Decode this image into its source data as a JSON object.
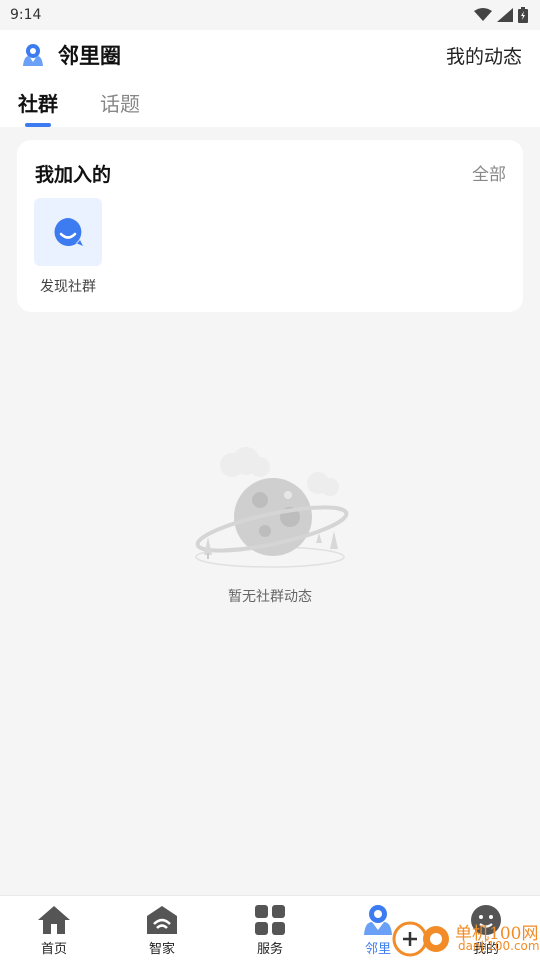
{
  "status_bar": {
    "time": "9:14"
  },
  "header": {
    "title": "邻里圈",
    "my_activity": "我的动态"
  },
  "tabs": [
    {
      "label": "社群",
      "active": true
    },
    {
      "label": "话题",
      "active": false
    }
  ],
  "joined": {
    "title": "我加入的",
    "all_label": "全部",
    "items": [
      {
        "label": "发现社群",
        "icon": "chat-bubble-icon"
      }
    ]
  },
  "empty_state": {
    "text": "暂无社群动态",
    "icon": "planet-illustration"
  },
  "bottom_nav": [
    {
      "label": "首页",
      "icon": "home-icon",
      "active": false
    },
    {
      "label": "智家",
      "icon": "smart-home-icon",
      "active": false
    },
    {
      "label": "服务",
      "icon": "grid-icon",
      "active": false
    },
    {
      "label": "邻里",
      "icon": "neighbor-icon",
      "active": true
    },
    {
      "label": "我的",
      "icon": "face-icon",
      "active": false
    }
  ],
  "watermark": {
    "line1": "单机100网",
    "line2": "danji100.com"
  },
  "colors": {
    "accent": "#3d7cf0",
    "background": "#f5f5f5",
    "tile": "#ebf2ff"
  }
}
